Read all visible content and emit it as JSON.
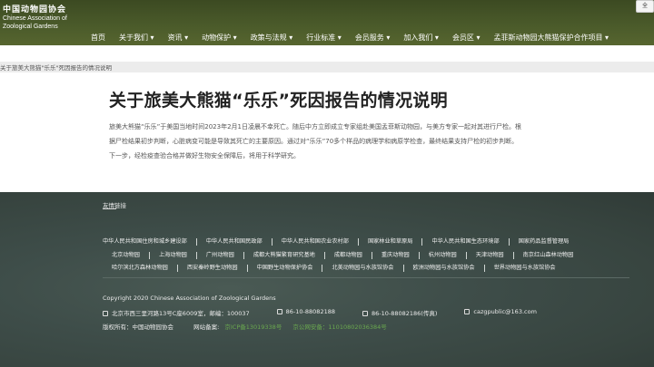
{
  "header": {
    "logo_cn": "中国动物园协会",
    "logo_en_line1": "Chinese Association of",
    "logo_en_line2": "Zoological Gardens",
    "corner_button": "全"
  },
  "nav": [
    "首页",
    "关于我们 ▾",
    "资讯 ▾",
    "动物保护 ▾",
    "政策与法规 ▾",
    "行业标准 ▾",
    "会员服务 ▾",
    "加入我们 ▾",
    "会员区 ▾",
    "孟菲斯动物园大熊猫保护合作项目 ▾"
  ],
  "breadcrumb": "关于旅美大熊猫\"乐乐\"死因报告的情况说明",
  "article": {
    "title": "关于旅美大熊猫“乐乐”死因报告的情况说明",
    "body": "旅美大熊猫“乐乐”于美国当地时间2023年2月1日凌晨不幸死亡。随后中方立即成立专家组赴美国孟菲斯动物园，与美方专家一起对其进行尸检。根据尸检结果初步判断，心脏病变可能是导致其死亡的主要原因。通过对“乐乐”70多个样品的病理学和病原学检查，最终结果支持尸检的初步判断。下一步，经检疫查验合格并做好生物安全保障后，将用于科学研究。"
  },
  "footer": {
    "links_heading": "友情链接",
    "links_rows": [
      [
        "中华人民共和国住房和城乡建设部",
        "中华人民共和国民政部",
        "中华人民共和国农业农村部",
        "国家林业和草原局",
        "中华人民共和国生态环境部",
        "国家药品监督管理局"
      ],
      [
        "北京动物园",
        "上海动物园",
        "广州动物园",
        "成都大熊猫繁育研究基地",
        "成都动物园",
        "重庆动物园",
        "杭州动物园",
        "天津动物园",
        "南京红山森林动物园"
      ],
      [
        "哈尔滨北方森林动物园",
        "西安秦岭野生动物园",
        "中国野生动物保护协会",
        "北美动物园与水族馆协会",
        "欧洲动物园与水族馆协会",
        "世界动物园与水族馆协会"
      ]
    ],
    "copyright": "Copyright 2020 Chinese Association of Zoological Gardens",
    "address": "北京市西三里河路13号C座6009室，邮编：100037",
    "phone1": "86-10-88082188",
    "phone2": "86-10-88082186(传真)",
    "email": "cazgpublic@163.com",
    "rights_label": "版权所有：中国动物园协会",
    "record_label": "网站备案:",
    "icp": "京ICP备13019338号",
    "police": "京公网安备：11010802036384号"
  }
}
